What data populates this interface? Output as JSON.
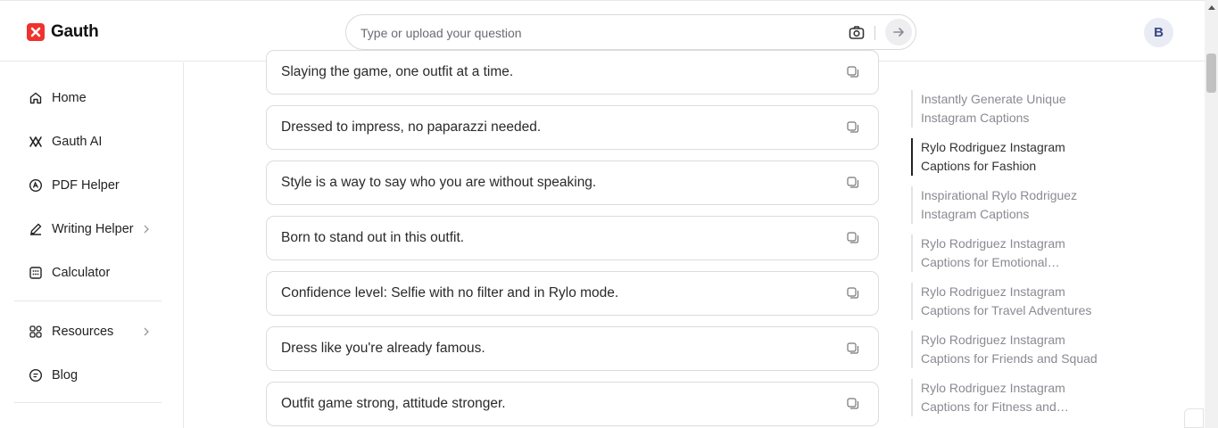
{
  "brand": {
    "name": "Gauth",
    "accent": "#f0322d"
  },
  "search": {
    "placeholder": "Type or upload your question",
    "camera_icon": "camera-icon",
    "send_icon": "arrow-right-icon"
  },
  "user": {
    "initial": "B"
  },
  "sidebar": {
    "items": [
      {
        "label": "Home",
        "icon": "home-icon"
      },
      {
        "label": "Gauth AI",
        "icon": "gauth-ai-icon"
      },
      {
        "label": "PDF Helper",
        "icon": "pdf-icon"
      },
      {
        "label": "Writing Helper",
        "icon": "pen-icon",
        "has_submenu": true
      },
      {
        "label": "Calculator",
        "icon": "calculator-icon"
      },
      {
        "label": "Resources",
        "icon": "grid-icon",
        "has_submenu": true
      },
      {
        "label": "Blog",
        "icon": "blog-icon"
      }
    ]
  },
  "captions": [
    "Slaying the game, one outfit at a time.",
    "Dressed to impress, no paparazzi needed.",
    "Style is a way to say who you are without speaking.",
    "Born to stand out in this outfit.",
    "Confidence level: Selfie with no filter and in Rylo mode.",
    "Dress like you're already famous.",
    "Outfit game strong, attitude stronger."
  ],
  "toc": [
    {
      "label": "Instantly Generate Unique Instagram Captions",
      "active": false
    },
    {
      "label": "Rylo Rodriguez Instagram Captions for Fashion",
      "active": true
    },
    {
      "label": "Inspirational Rylo Rodriguez Instagram Captions",
      "active": false
    },
    {
      "label": "Rylo Rodriguez Instagram Captions for Emotional…",
      "active": false
    },
    {
      "label": "Rylo Rodriguez Instagram Captions for Travel Adventures",
      "active": false
    },
    {
      "label": "Rylo Rodriguez Instagram Captions for Friends and Squad",
      "active": false
    },
    {
      "label": "Rylo Rodriguez Instagram Captions for Fitness and…",
      "active": false
    }
  ]
}
